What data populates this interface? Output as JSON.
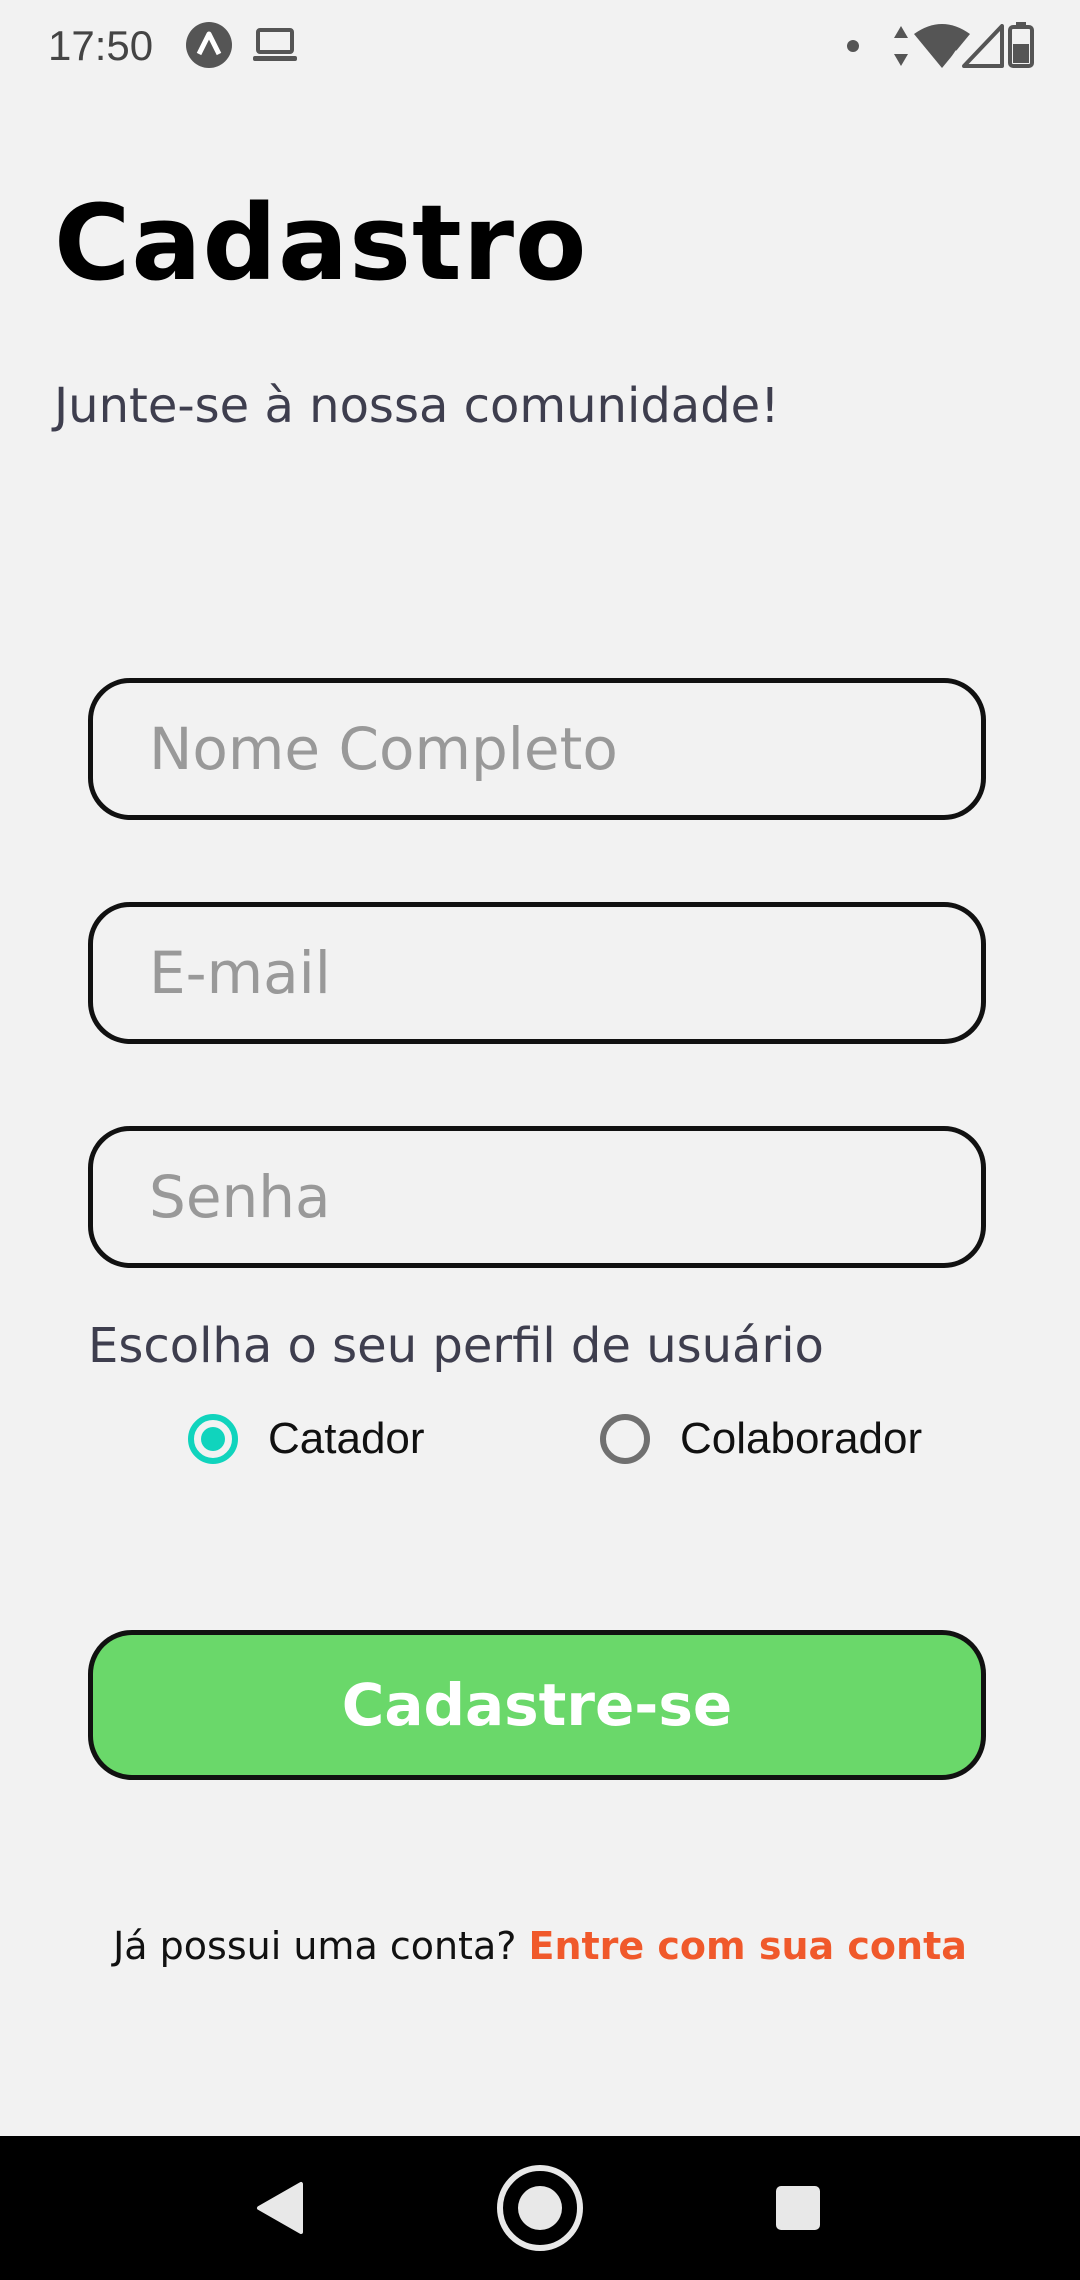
{
  "status_bar": {
    "time": "17:50",
    "left_icons": [
      "app-notification-icon",
      "laptop-icon"
    ],
    "right_icons": [
      "dot-icon",
      "data-arrows-icon",
      "wifi-icon",
      "signal-icon",
      "battery-icon"
    ],
    "wifi_badge": "4"
  },
  "header": {
    "title": "Cadastro",
    "subtitle": "Junte-se à nossa comunidade!"
  },
  "form": {
    "name_placeholder": "Nome Completo",
    "email_placeholder": "E-mail",
    "password_placeholder": "Senha",
    "name_value": "",
    "email_value": "",
    "password_value": ""
  },
  "profile": {
    "label": "Escolha o seu perfil de usuário",
    "options": [
      {
        "label": "Catador",
        "selected": true
      },
      {
        "label": "Colaborador",
        "selected": false
      }
    ]
  },
  "submit": {
    "label": "Cadastre-se",
    "color": "#6ad86a"
  },
  "login": {
    "prompt": "Já possui uma conta? ",
    "link": "Entre com sua conta",
    "link_color": "#f0592b"
  },
  "navigation": {
    "buttons": [
      "back-icon",
      "home-icon",
      "recents-icon"
    ]
  },
  "colors": {
    "background": "#f2f2f2",
    "accent_radio": "#10d4bd"
  }
}
